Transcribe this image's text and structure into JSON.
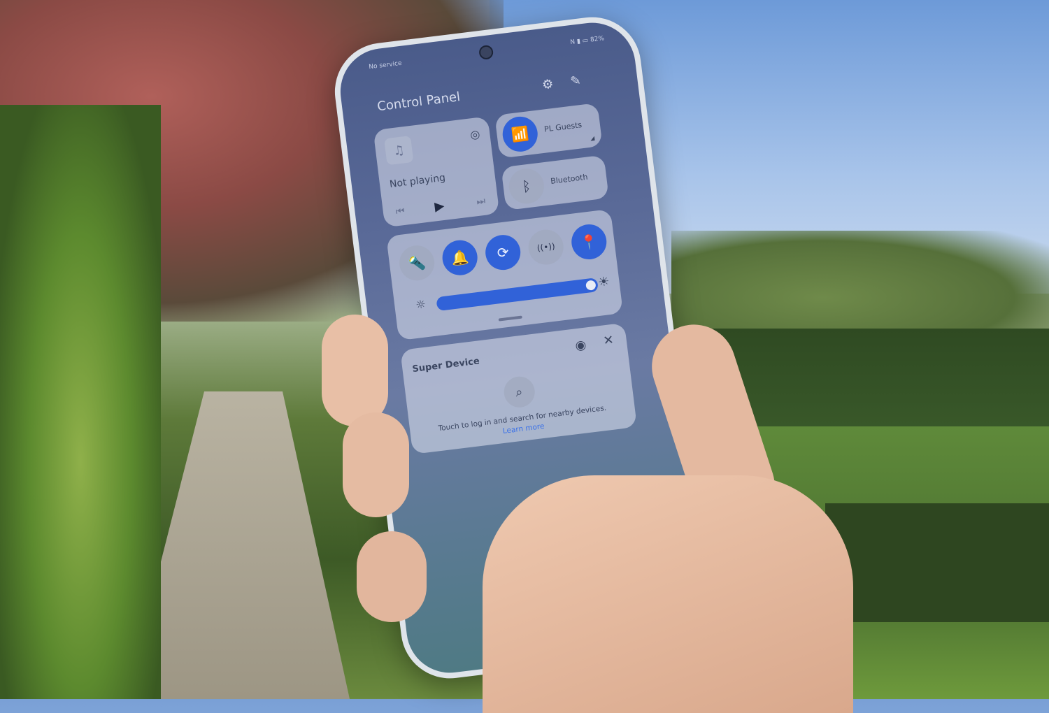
{
  "status_bar": {
    "carrier": "No service",
    "icons": [
      "nfc-icon",
      "signal-icon",
      "sim-icon",
      "battery-icon"
    ],
    "battery": "82%"
  },
  "control_panel": {
    "title": "Control Panel",
    "settings_icon": "gear-icon",
    "edit_icon": "edit-icon",
    "media": {
      "status": "Not playing",
      "icon": "music-note-icon",
      "cast_icon": "audio-cast-icon",
      "prev_icon": "previous-icon",
      "play_icon": "play-icon",
      "next_icon": "next-icon"
    },
    "wifi": {
      "label": "PL Guests",
      "active": true
    },
    "bluetooth": {
      "label": "Bluetooth",
      "active": false
    },
    "toggles": [
      {
        "name": "flashlight",
        "glyph": "🔦",
        "active": false
      },
      {
        "name": "sound",
        "glyph": "🔔",
        "active": true
      },
      {
        "name": "auto-rotate",
        "glyph": "⟳",
        "active": true
      },
      {
        "name": "hotspot",
        "glyph": "((•))",
        "active": false
      },
      {
        "name": "location",
        "glyph": "📍",
        "active": true
      }
    ],
    "brightness": {
      "level_percent": 95
    }
  },
  "super_device": {
    "title": "Super Device",
    "message": "Touch to log in and search for nearby devices.",
    "link": "Learn more"
  },
  "colors": {
    "accent": "#3162d8",
    "link": "#3a70e8"
  }
}
